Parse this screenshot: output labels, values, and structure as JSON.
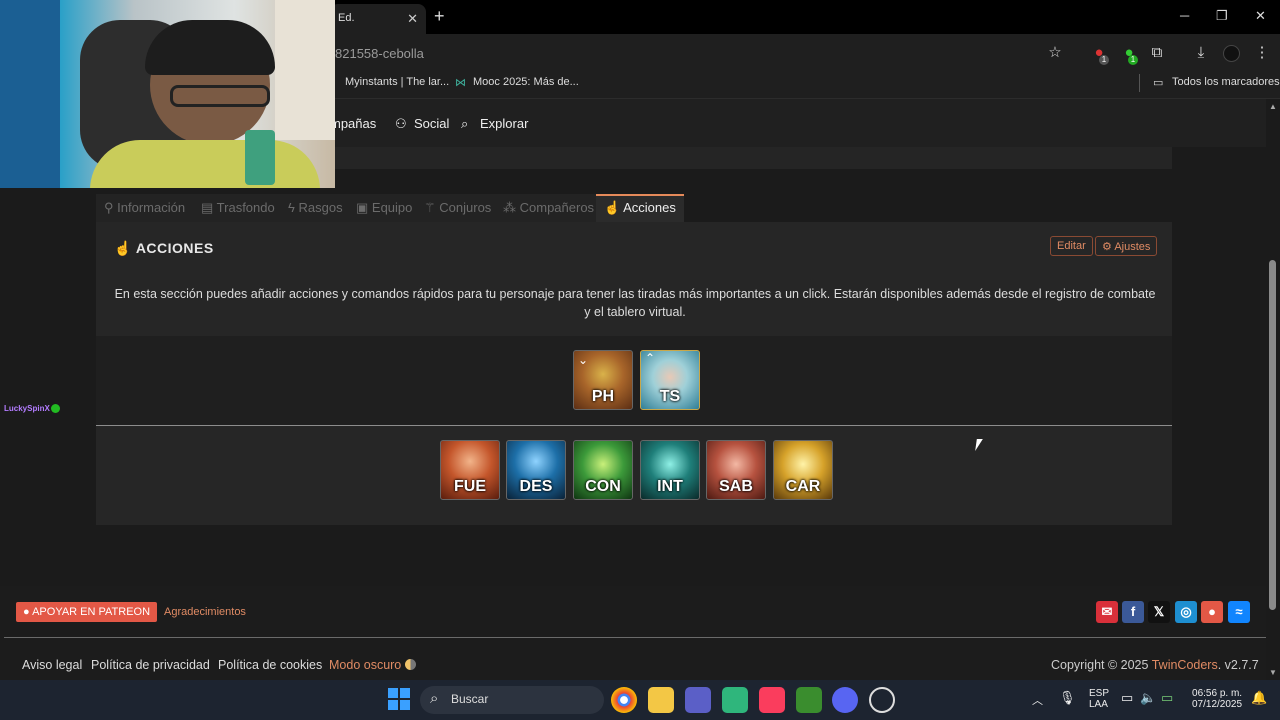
{
  "browser": {
    "tab_title": "Ed.",
    "url": "821558-cebolla",
    "bookmarks": [
      "Myinstants | The lar...",
      "Mooc 2025: Más de..."
    ],
    "all_bookmarks": "Todos los marcadores",
    "extension_badge_1": "1",
    "extension_badge_2": "1"
  },
  "site_nav": {
    "campaigns": "mpañas",
    "social": "Social",
    "explore": "Explorar"
  },
  "chat_overlay": {
    "user": "LuckySpinX :"
  },
  "tabs": [
    {
      "label": "Información"
    },
    {
      "label": "Trasfondo"
    },
    {
      "label": "Rasgos"
    },
    {
      "label": "Equipo"
    },
    {
      "label": "Conjuros"
    },
    {
      "label": "Compañeros"
    },
    {
      "label": "Acciones"
    }
  ],
  "panel": {
    "title": "ACCIONES",
    "edit": "Editar",
    "settings": "Ajustes",
    "description": "En esta sección puedes añadir acciones y comandos rápidos para tu personaje para tener las tiradas más importantes a un click. Estarán disponibles además desde el registro de combate y el tablero virtual."
  },
  "quick_actions": [
    "PH",
    "TS"
  ],
  "abilities": [
    "FUE",
    "DES",
    "CON",
    "INT",
    "SAB",
    "CAR"
  ],
  "footer": {
    "patreon": "APOYAR EN PATREON",
    "thanks": "Agradecimientos",
    "links": [
      "Aviso legal",
      "Política de privacidad",
      "Política de cookies"
    ],
    "dark_mode": "Modo oscuro",
    "copyright_prefix": "Copyright © 2025",
    "brand": "TwinCoders",
    "version": ". v2.7.7"
  },
  "taskbar": {
    "search": "Buscar",
    "lang1": "ESP",
    "lang2": "LAA",
    "time": "06:56 p. m.",
    "date": "07/12/2025"
  },
  "colors": {
    "accent": "#e58a5a",
    "patreon": "#e35846",
    "mail": "#d9303a",
    "facebook": "#3b5998",
    "instagram": "#1e8fd1",
    "patreon_icon": "#e35846",
    "bluesky": "#1185fe"
  }
}
